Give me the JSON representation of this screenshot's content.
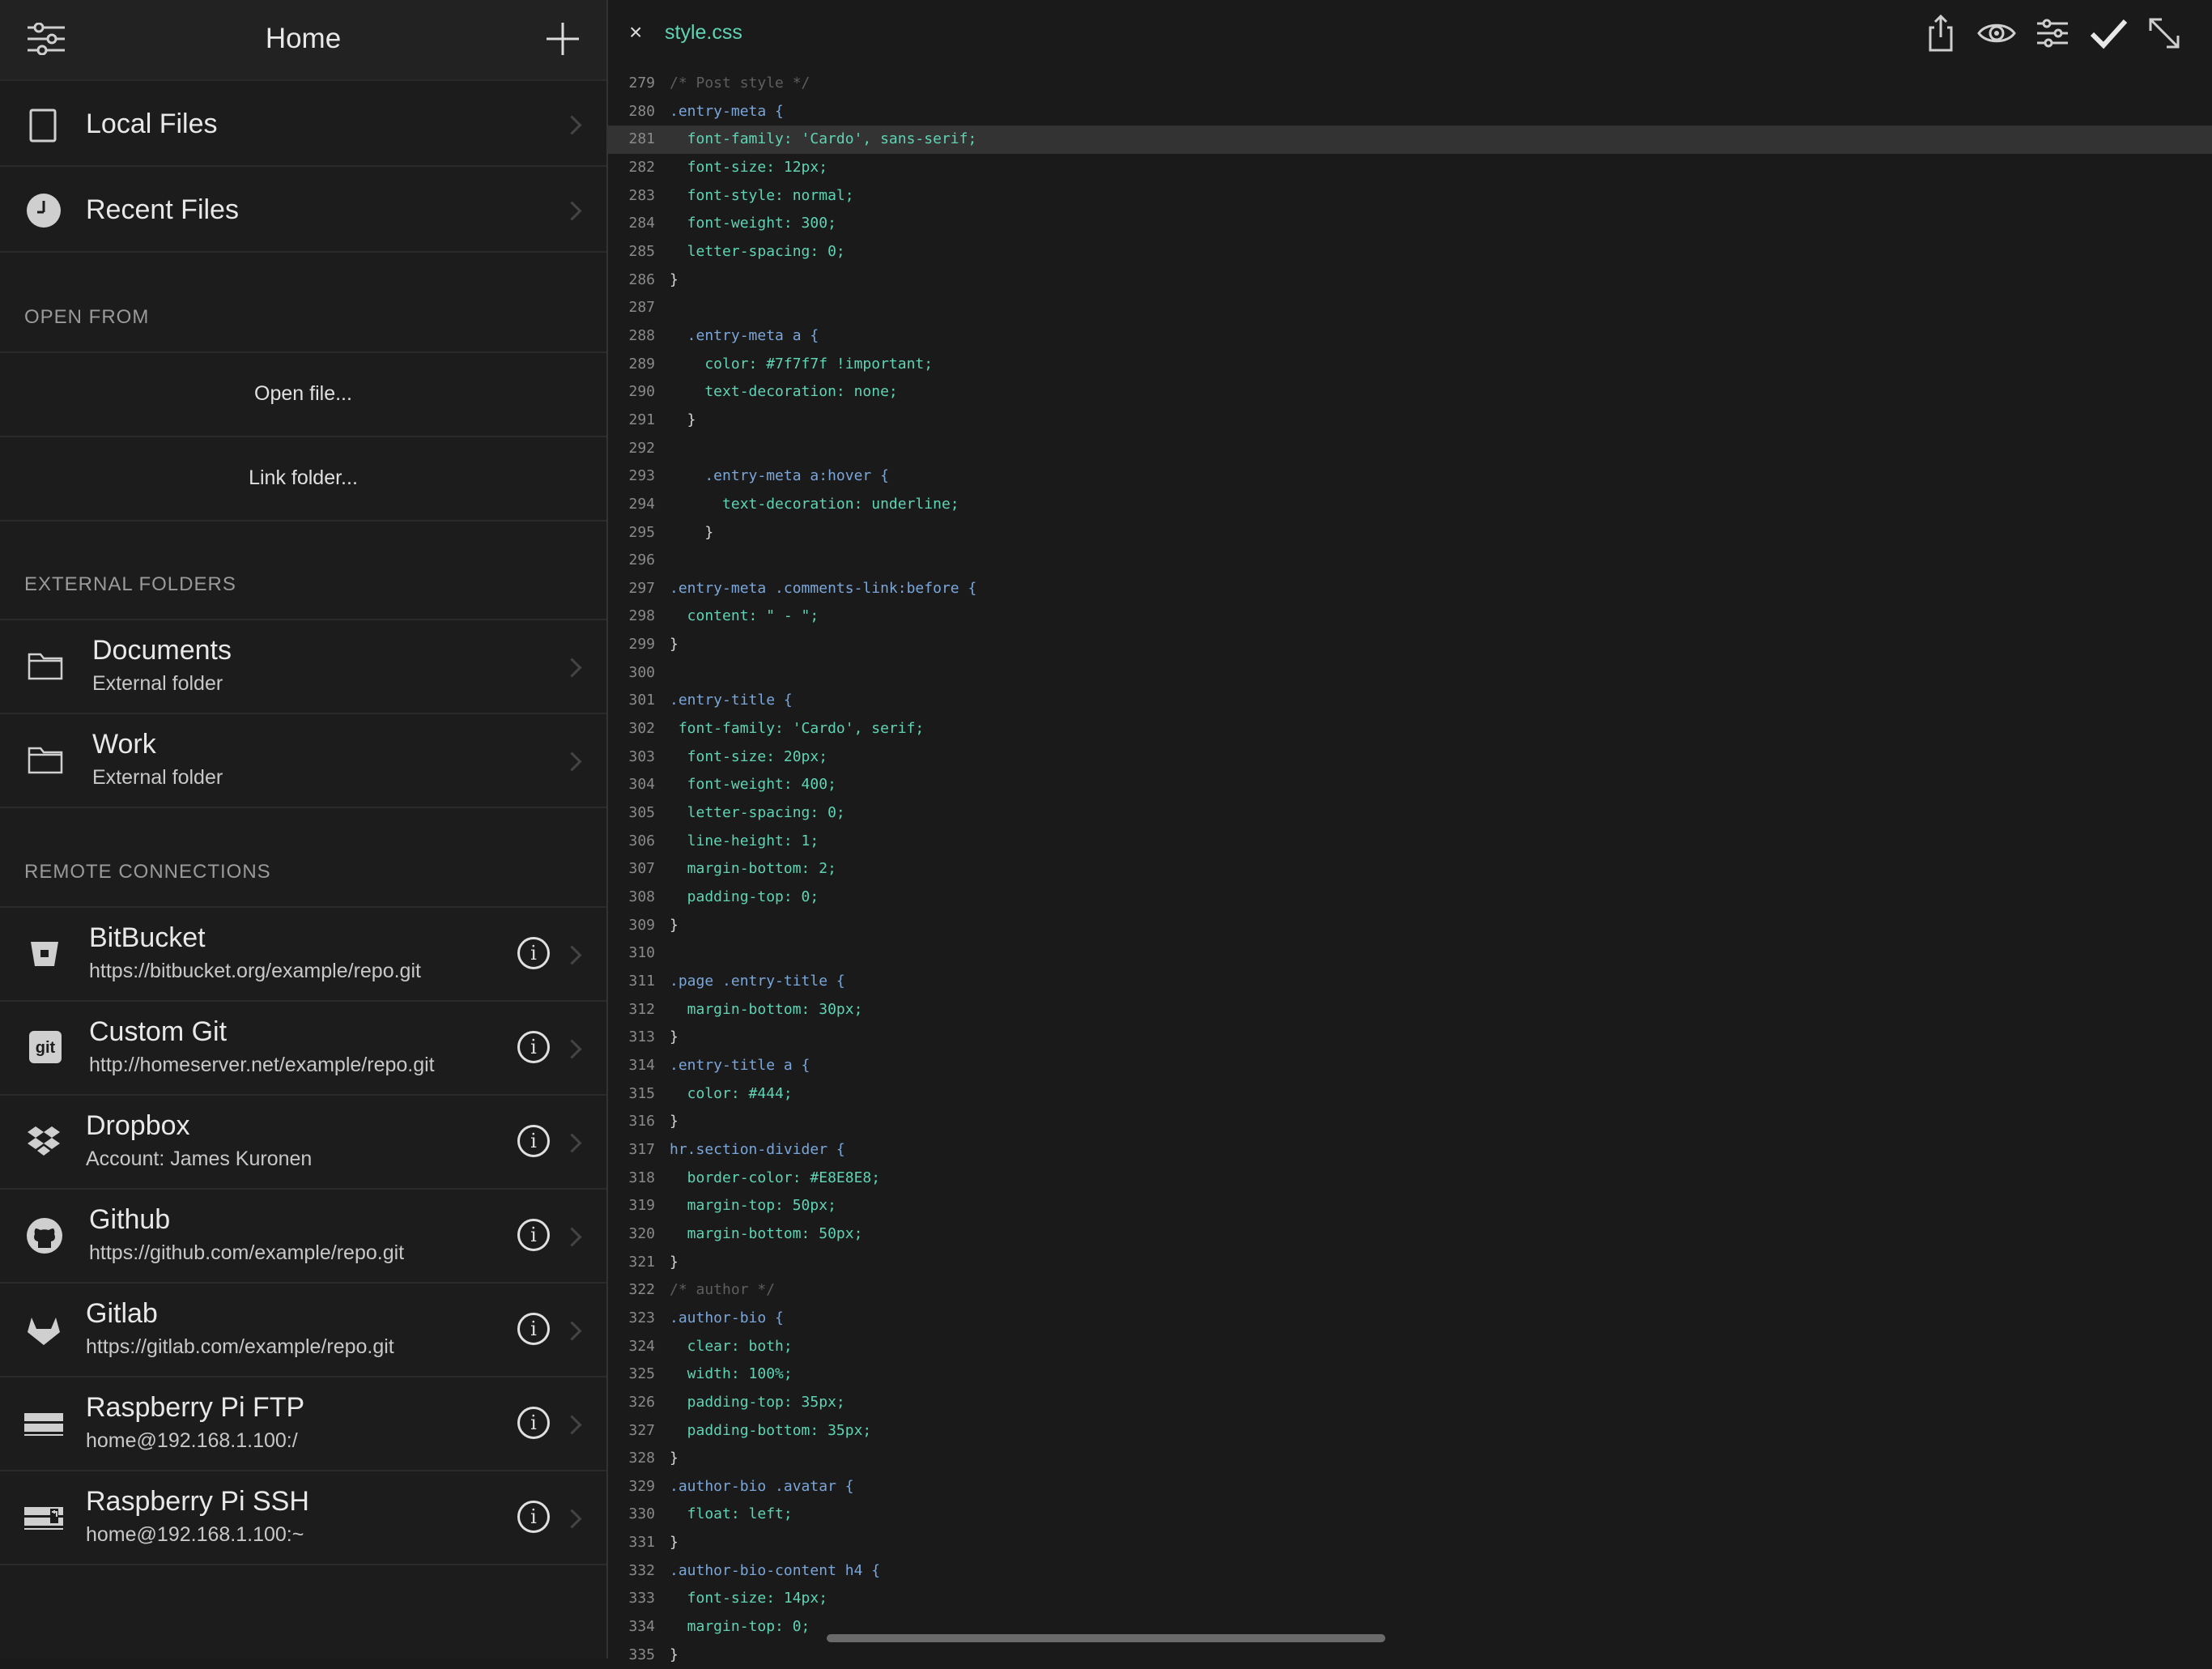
{
  "sidebar": {
    "title": "Home",
    "local_files": "Local Files",
    "recent_files": "Recent Files",
    "open_from_title": "OPEN FROM",
    "open_file": "Open file...",
    "link_folder": "Link folder...",
    "external_title": "EXTERNAL FOLDERS",
    "external": [
      {
        "name": "Documents",
        "sub": "External folder"
      },
      {
        "name": "Work",
        "sub": "External folder"
      }
    ],
    "remote_title": "REMOTE CONNECTIONS",
    "remote": [
      {
        "name": "BitBucket",
        "sub": "https://bitbucket.org/example/repo.git",
        "icon": "bitbucket-icon"
      },
      {
        "name": "Custom Git",
        "sub": "http://homeserver.net/example/repo.git",
        "icon": "git-icon"
      },
      {
        "name": "Dropbox",
        "sub": "Account: James Kuronen",
        "icon": "dropbox-icon"
      },
      {
        "name": "Github",
        "sub": "https://github.com/example/repo.git",
        "icon": "github-icon"
      },
      {
        "name": "Gitlab",
        "sub": "https://gitlab.com/example/repo.git",
        "icon": "gitlab-icon"
      },
      {
        "name": "Raspberry Pi FTP",
        "sub": "home@192.168.1.100:/",
        "icon": "ftp-server-icon"
      },
      {
        "name": "Raspberry Pi SSH",
        "sub": "home@192.168.1.100:~",
        "icon": "ssh-server-icon"
      }
    ]
  },
  "editor": {
    "filename": "style.css",
    "close": "×",
    "active_line": 281,
    "lines": [
      {
        "n": "279",
        "t": "/* Post style */",
        "c": "#5e5e5e"
      },
      {
        "n": "280",
        "t": ".entry-meta {",
        "c": "#7aa6da"
      },
      {
        "n": "281",
        "t": "  font-family: 'Cardo', sans-serif;",
        "c": "#5fd4b4"
      },
      {
        "n": "282",
        "t": "  font-size: 12px;",
        "c": "#5fd4b4"
      },
      {
        "n": "283",
        "t": "  font-style: normal;",
        "c": "#5fd4b4"
      },
      {
        "n": "284",
        "t": "  font-weight: 300;",
        "c": "#5fd4b4"
      },
      {
        "n": "285",
        "t": "  letter-spacing: 0;",
        "c": "#5fd4b4"
      },
      {
        "n": "286",
        "t": "}",
        "c": "#d8d8d8"
      },
      {
        "n": "287",
        "t": "",
        "c": "#d8d8d8"
      },
      {
        "n": "288",
        "t": "  .entry-meta a {",
        "c": "#7aa6da"
      },
      {
        "n": "289",
        "t": "    color: #7f7f7f !important;",
        "c": "#5fd4b4"
      },
      {
        "n": "290",
        "t": "    text-decoration: none;",
        "c": "#5fd4b4"
      },
      {
        "n": "291",
        "t": "  }",
        "c": "#d8d8d8"
      },
      {
        "n": "292",
        "t": "",
        "c": "#d8d8d8"
      },
      {
        "n": "293",
        "t": "    .entry-meta a:hover {",
        "c": "#7aa6da"
      },
      {
        "n": "294",
        "t": "      text-decoration: underline;",
        "c": "#5fd4b4"
      },
      {
        "n": "295",
        "t": "    }",
        "c": "#d8d8d8"
      },
      {
        "n": "296",
        "t": "",
        "c": "#d8d8d8"
      },
      {
        "n": "297",
        "t": ".entry-meta .comments-link:before {",
        "c": "#7aa6da"
      },
      {
        "n": "298",
        "t": "  content: \" - \";",
        "c": "#5fd4b4"
      },
      {
        "n": "299",
        "t": "}",
        "c": "#d8d8d8"
      },
      {
        "n": "300",
        "t": "",
        "c": "#d8d8d8"
      },
      {
        "n": "301",
        "t": ".entry-title {",
        "c": "#7aa6da"
      },
      {
        "n": "302",
        "t": " font-family: 'Cardo', serif;",
        "c": "#5fd4b4"
      },
      {
        "n": "303",
        "t": "  font-size: 20px;",
        "c": "#5fd4b4"
      },
      {
        "n": "304",
        "t": "  font-weight: 400;",
        "c": "#5fd4b4"
      },
      {
        "n": "305",
        "t": "  letter-spacing: 0;",
        "c": "#5fd4b4"
      },
      {
        "n": "306",
        "t": "  line-height: 1;",
        "c": "#5fd4b4"
      },
      {
        "n": "307",
        "t": "  margin-bottom: 2;",
        "c": "#5fd4b4"
      },
      {
        "n": "308",
        "t": "  padding-top: 0;",
        "c": "#5fd4b4"
      },
      {
        "n": "309",
        "t": "}",
        "c": "#d8d8d8"
      },
      {
        "n": "310",
        "t": "",
        "c": "#d8d8d8"
      },
      {
        "n": "311",
        "t": ".page .entry-title {",
        "c": "#7aa6da"
      },
      {
        "n": "312",
        "t": "  margin-bottom: 30px;",
        "c": "#5fd4b4"
      },
      {
        "n": "313",
        "t": "}",
        "c": "#d8d8d8"
      },
      {
        "n": "314",
        "t": ".entry-title a {",
        "c": "#7aa6da"
      },
      {
        "n": "315",
        "t": "  color: #444;",
        "c": "#5fd4b4"
      },
      {
        "n": "316",
        "t": "}",
        "c": "#d8d8d8"
      },
      {
        "n": "317",
        "t": "hr.section-divider {",
        "c": "#7aa6da"
      },
      {
        "n": "318",
        "t": "  border-color: #E8E8E8;",
        "c": "#5fd4b4"
      },
      {
        "n": "319",
        "t": "  margin-top: 50px;",
        "c": "#5fd4b4"
      },
      {
        "n": "320",
        "t": "  margin-bottom: 50px;",
        "c": "#5fd4b4"
      },
      {
        "n": "321",
        "t": "}",
        "c": "#d8d8d8"
      },
      {
        "n": "322",
        "t": "/* author */",
        "c": "#5e5e5e"
      },
      {
        "n": "323",
        "t": ".author-bio {",
        "c": "#7aa6da"
      },
      {
        "n": "324",
        "t": "  clear: both;",
        "c": "#5fd4b4"
      },
      {
        "n": "325",
        "t": "  width: 100%;",
        "c": "#5fd4b4"
      },
      {
        "n": "326",
        "t": "  padding-top: 35px;",
        "c": "#5fd4b4"
      },
      {
        "n": "327",
        "t": "  padding-bottom: 35px;",
        "c": "#5fd4b4"
      },
      {
        "n": "328",
        "t": "}",
        "c": "#d8d8d8"
      },
      {
        "n": "329",
        "t": ".author-bio .avatar {",
        "c": "#7aa6da"
      },
      {
        "n": "330",
        "t": "  float: left;",
        "c": "#5fd4b4"
      },
      {
        "n": "331",
        "t": "}",
        "c": "#d8d8d8"
      },
      {
        "n": "332",
        "t": ".author-bio-content h4 {",
        "c": "#7aa6da"
      },
      {
        "n": "333",
        "t": "  font-size: 14px;",
        "c": "#5fd4b4"
      },
      {
        "n": "334",
        "t": "  margin-top: 0;",
        "c": "#5fd4b4"
      },
      {
        "n": "335",
        "t": "}",
        "c": "#d8d8d8"
      }
    ]
  }
}
